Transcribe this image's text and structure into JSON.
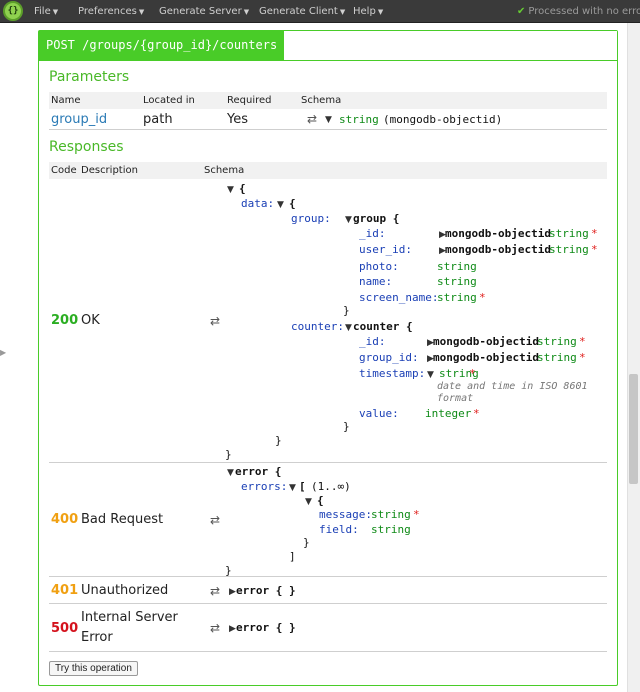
{
  "menu": [
    {
      "label": "File"
    },
    {
      "label": "Preferences"
    },
    {
      "label": "Generate Server"
    },
    {
      "label": "Generate Client"
    },
    {
      "label": "Help"
    }
  ],
  "status": {
    "text": "Processed with no error"
  },
  "logo": {
    "text": "{}"
  },
  "operation": {
    "label": "POST /groups/{group_id}/counters",
    "color": "#49cc28"
  },
  "parameters": {
    "title": "Parameters",
    "headers": [
      "Name",
      "Located in",
      "Required",
      "Schema"
    ],
    "rows": [
      {
        "name": "group_id",
        "located_in": "path",
        "required": "Yes",
        "schema_type": "string",
        "schema_format": "(mongodb-objectid)"
      }
    ]
  },
  "responses": {
    "title": "Responses",
    "headers": [
      "Code",
      "Description",
      "Schema"
    ],
    "r200": {
      "code": "200",
      "desc": "OK",
      "schema": {
        "open": "{",
        "close": "}",
        "data_key": "data:",
        "data_open": "{",
        "data_close": "}",
        "group_key": "group:",
        "group_name": "group {",
        "group_close": "}",
        "g_id_key": "_id:",
        "g_id_type": "mongodb-objectid",
        "g_id_base": "string",
        "g_id_req": "*",
        "g_user_key": "user_id:",
        "g_user_type": "mongodb-objectid",
        "g_user_base": "string",
        "g_user_req": "*",
        "g_photo_key": "photo:",
        "g_photo_type": "string",
        "g_name_key": "name:",
        "g_name_type": "string",
        "g_sn_key": "screen_name:",
        "g_sn_type": "string",
        "g_sn_req": "*",
        "counter_key": "counter:",
        "counter_name": "counter {",
        "counter_close": "}",
        "c_id_key": "_id:",
        "c_id_type": "mongodb-objectid",
        "c_id_base": "string",
        "c_id_req": "*",
        "c_gid_key": "group_id:",
        "c_gid_type": "mongodb-objectid",
        "c_gid_base": "string",
        "c_gid_req": "*",
        "c_ts_key": "timestamp:",
        "c_ts_type": "string",
        "c_ts_req": "*",
        "c_ts_desc1": "date and time in ISO 8601",
        "c_ts_desc2": "format",
        "c_val_key": "value:",
        "c_val_type": "integer",
        "c_val_req": "*"
      }
    },
    "r400": {
      "code": "400",
      "desc": "Bad Request",
      "schema": {
        "name": "error {",
        "close": "}",
        "errors_key": "errors:",
        "errors_open": "[",
        "errors_range": "(1..∞)",
        "errors_close": "]",
        "item_open": "{",
        "item_close": "}",
        "msg_key": "message:",
        "msg_type": "string",
        "msg_req": "*",
        "field_key": "field:",
        "field_type": "string"
      }
    },
    "r401": {
      "code": "401",
      "desc": "Unauthorized",
      "schema": "error { }"
    },
    "r500": {
      "code": "500",
      "desc_line1": "Internal Server",
      "desc_line2": "Error",
      "schema": "error { }"
    }
  },
  "try_button": {
    "label": "Try this operation"
  }
}
